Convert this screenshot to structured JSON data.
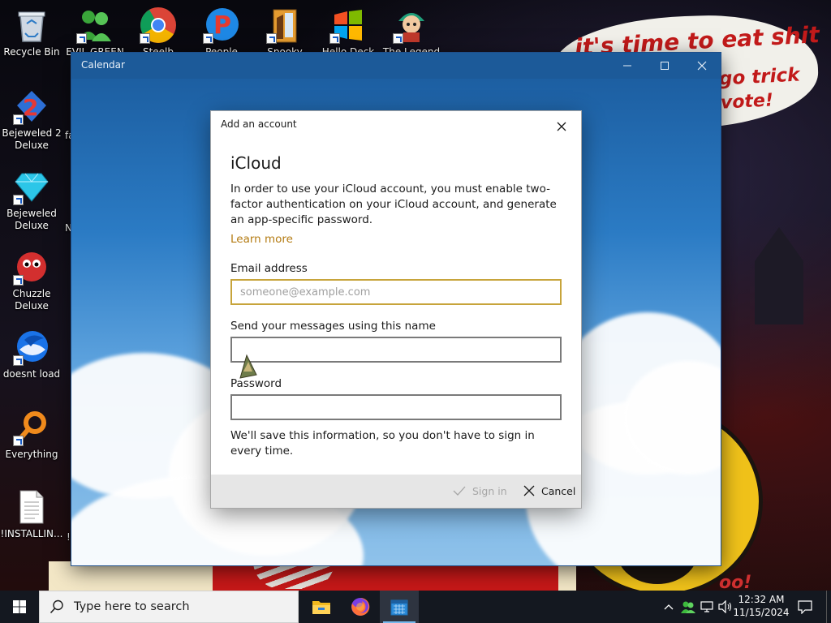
{
  "desktop": {
    "icons": [
      {
        "label": "Recycle Bin",
        "icon": "recycle-bin-icon"
      },
      {
        "label": "EVIL GREEN",
        "icon": "green-users-icon"
      },
      {
        "label": "Steelb",
        "icon": "chrome-icon"
      },
      {
        "label": "People Nights",
        "icon": "people-nights-icon"
      },
      {
        "label": "Spooky",
        "icon": "spooky-icon"
      },
      {
        "label": "Hello Deck",
        "icon": "windows-logo-icon"
      },
      {
        "label": "The Legend",
        "icon": "legend-character-icon"
      },
      {
        "label": "Bejeweled 2\nDeluxe",
        "icon": "bejeweled-2-icon"
      },
      {
        "label": "Bejeweled\nDeluxe",
        "icon": "bejeweled-diamond-icon"
      },
      {
        "label": "Chuzzle\nDeluxe",
        "icon": "chuzzle-icon"
      },
      {
        "label": "doesnt load",
        "icon": "thunderbird-icon"
      },
      {
        "label": "Everything",
        "icon": "everything-search-icon"
      },
      {
        "label": "!INSTALLIN...",
        "icon": "text-document-icon"
      }
    ],
    "partial_labels": [
      "fa",
      "N",
      "!"
    ],
    "wallpaper_text": {
      "line1": "it's time to eat shit",
      "line2": "go trick",
      "line3": "vote!"
    }
  },
  "calendar_window": {
    "title": "Calendar",
    "controls": {
      "minimize": "minimize",
      "maximize": "maximize",
      "close": "close"
    }
  },
  "dialog": {
    "header": "Add an account",
    "heading": "iCloud",
    "description": "In order to use your iCloud account, you must enable two-factor authentication on your iCloud account, and generate an app-specific password.",
    "learn_more": "Learn more",
    "email": {
      "label": "Email address",
      "placeholder": "someone@example.com",
      "value": ""
    },
    "name": {
      "label": "Send your messages using this name",
      "value": ""
    },
    "password": {
      "label": "Password",
      "value": ""
    },
    "note": "We'll save this information, so you don't have to sign in every time.",
    "buttons": {
      "sign_in": "Sign in",
      "cancel": "Cancel"
    }
  },
  "taskbar": {
    "search_placeholder": "Type here to search",
    "apps": [
      "file-explorer-icon",
      "firefox-icon",
      "calendar-icon"
    ],
    "active_app": "calendar-icon",
    "clock": {
      "time": "12:32 AM",
      "date": "11/15/2024"
    },
    "colors": {
      "accent": "#76b9ed",
      "link": "#b47b12",
      "focus_border": "#c7a43b"
    }
  }
}
